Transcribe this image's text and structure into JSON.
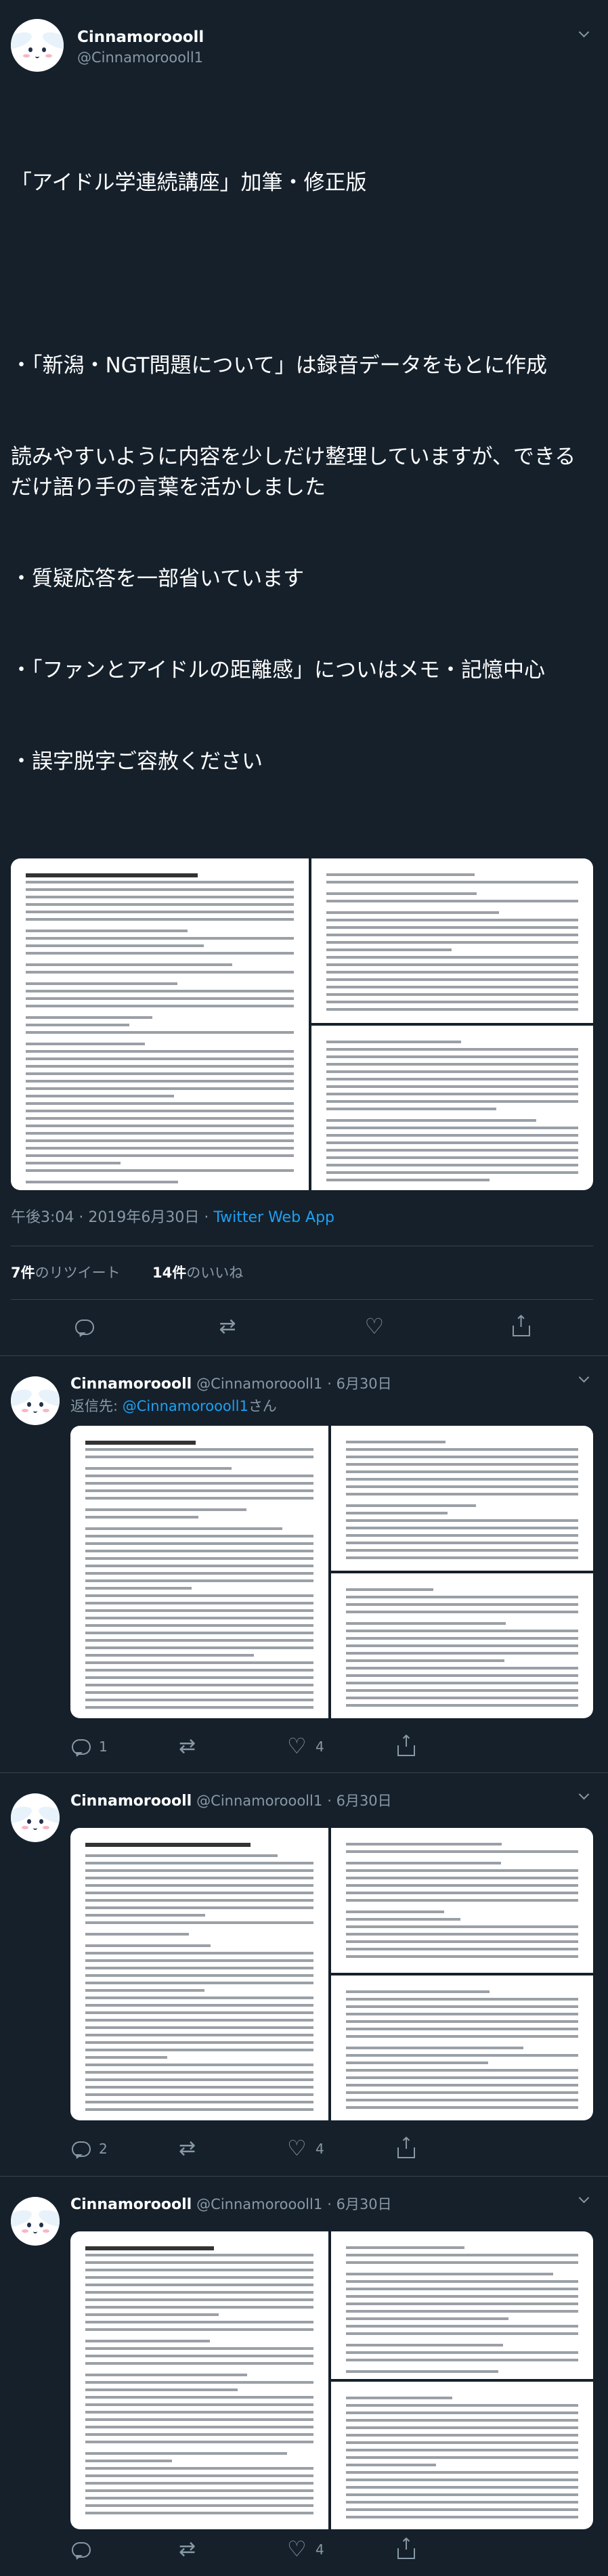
{
  "main_tweet": {
    "display_name": "Cinnamoroooll",
    "username": "@Cinnamoroooll1",
    "text_lines": [
      "「アイドル学連続講座」加筆・修正版",
      "",
      "・「新潟・NGT問題について」は録音データをもとに作成",
      "読みやすいように内容を少しだけ整理していますが、できるだけ語り手の言葉を活かしました",
      "・質疑応答を一部省いています",
      "・「ファンとアイドルの距離感」についはメモ・記憶中心",
      "・誤字脱字ご容赦ください"
    ],
    "timestamp": "午後3:04 · 2019年6月30日 · ",
    "source": "Twitter Web App",
    "retweet_count": "7件",
    "retweet_label": "のリツイート",
    "like_count": "14件",
    "like_label": "のいいね"
  },
  "replies": [
    {
      "display_name": "Cinnamoroooll",
      "username": "@Cinnamoroooll1",
      "date": "6月30日",
      "reply_to_label": "返信先: ",
      "reply_to_user": "@Cinnamoroooll1",
      "reply_to_suffix": "さん",
      "reply_count": "1",
      "retweet_count": "",
      "like_count": "4"
    },
    {
      "display_name": "Cinnamoroooll",
      "username": "@Cinnamoroooll1",
      "date": "6月30日",
      "reply_count": "2",
      "retweet_count": "",
      "like_count": "4"
    },
    {
      "display_name": "Cinnamoroooll",
      "username": "@Cinnamoroooll1",
      "date": "6月30日",
      "reply_count": "",
      "retweet_count": "",
      "like_count": "4"
    }
  ],
  "colors": {
    "background": "#15202b",
    "accent": "#1da1f2",
    "muted": "#8899a6",
    "divider": "#38444d"
  }
}
